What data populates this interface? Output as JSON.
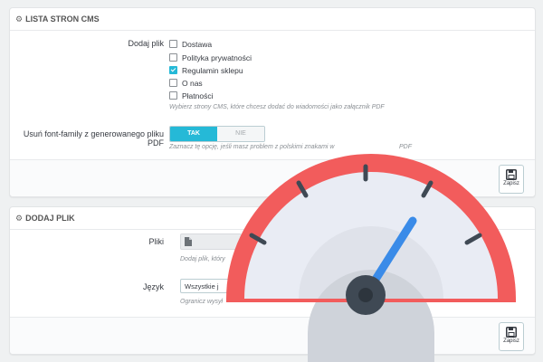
{
  "panel_cms": {
    "title": "LISTA STRON CMS",
    "add_file_label": "Dodaj plik",
    "checkboxes": [
      {
        "label": "Dostawa",
        "checked": false
      },
      {
        "label": "Polityka prywatności",
        "checked": false
      },
      {
        "label": "Regulamin sklepu",
        "checked": true
      },
      {
        "label": "O nas",
        "checked": false
      },
      {
        "label": "Płatności",
        "checked": false
      }
    ],
    "checkbox_help": "Wybierz strony CMS, które chcesz dodać do wiadomości jako załącznik PDF",
    "font_label": "Usuń font-family z generowanego pliku PDF",
    "toggle_on": "TAK",
    "toggle_off": "NIE",
    "font_help": "Zaznacz tę opcję, jeśli masz problem z polskimi znakami w",
    "font_help_tail": "PDF",
    "save_label": "Zapisz"
  },
  "panel_add": {
    "title": "DODAJ PLIK",
    "files_label": "Pliki",
    "files_help": "Dodaj plik, który",
    "language_label": "Język",
    "language_value": "Wszystkie j",
    "language_help": "Ogranicz wysył",
    "save_label": "Zapisz"
  },
  "colors": {
    "accent": "#25b9d7",
    "gauge_rim": "#f25c5c",
    "gauge_needle": "#3a8be8",
    "gauge_face": "#e9ecf4"
  },
  "icons": {
    "settings": "gear-icon",
    "save": "floppy-disk-icon",
    "file": "file-icon",
    "gauge": "speedometer-icon"
  }
}
